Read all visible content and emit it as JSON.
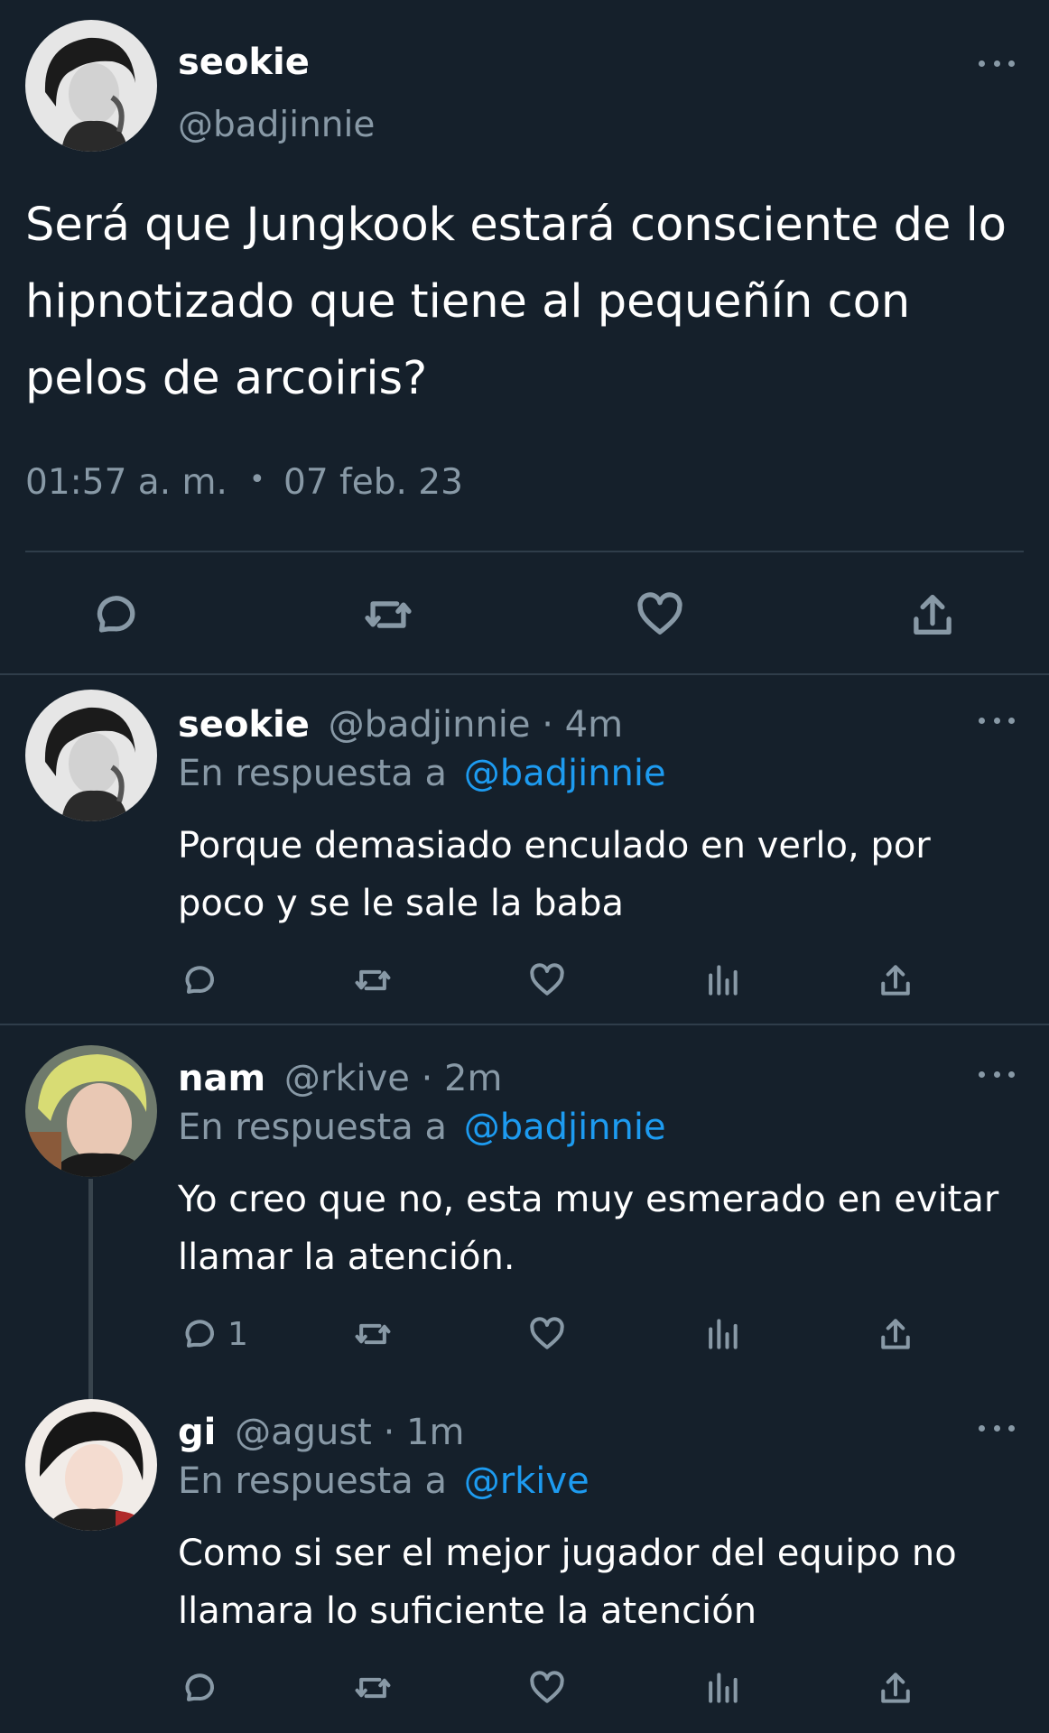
{
  "main_tweet": {
    "display_name": "seokie",
    "handle": "@badjinnie",
    "text_lines": [
      "Será que Jungkook estará consciente de lo",
      "hipnotizado que tiene al pequeñín con",
      "pelos de arcoiris?"
    ],
    "time": "01:57 a. m.",
    "separator": "•",
    "date": "07 feb. 23"
  },
  "replies": [
    {
      "display_name": "seokie",
      "handle": "@badjinnie",
      "age": "· 4m",
      "reply_prefix": "En respuesta a",
      "reply_to": "@badjinnie",
      "text_lines": [
        "Porque demasiado enculado en verlo, por",
        "poco y se le sale la baba"
      ],
      "reply_count": ""
    },
    {
      "display_name": "nam",
      "handle": "@rkive",
      "age": "· 2m",
      "reply_prefix": "En respuesta a",
      "reply_to": "@badjinnie",
      "text_lines": [
        "Yo creo que no, esta muy esmerado en evitar",
        "llamar la atención."
      ],
      "reply_count": "1"
    },
    {
      "display_name": "gi",
      "handle": "@agust",
      "age": "· 1m",
      "reply_prefix": "En respuesta a",
      "reply_to": "@rkive",
      "text_lines": [
        "Como si ser el mejor jugador del equipo no",
        "llamara lo suficiente la atención"
      ],
      "reply_count": ""
    }
  ],
  "colors": {
    "background": "#15202b",
    "muted": "#8899a6",
    "link": "#1d9bf0",
    "divider": "#2f3d4a"
  }
}
